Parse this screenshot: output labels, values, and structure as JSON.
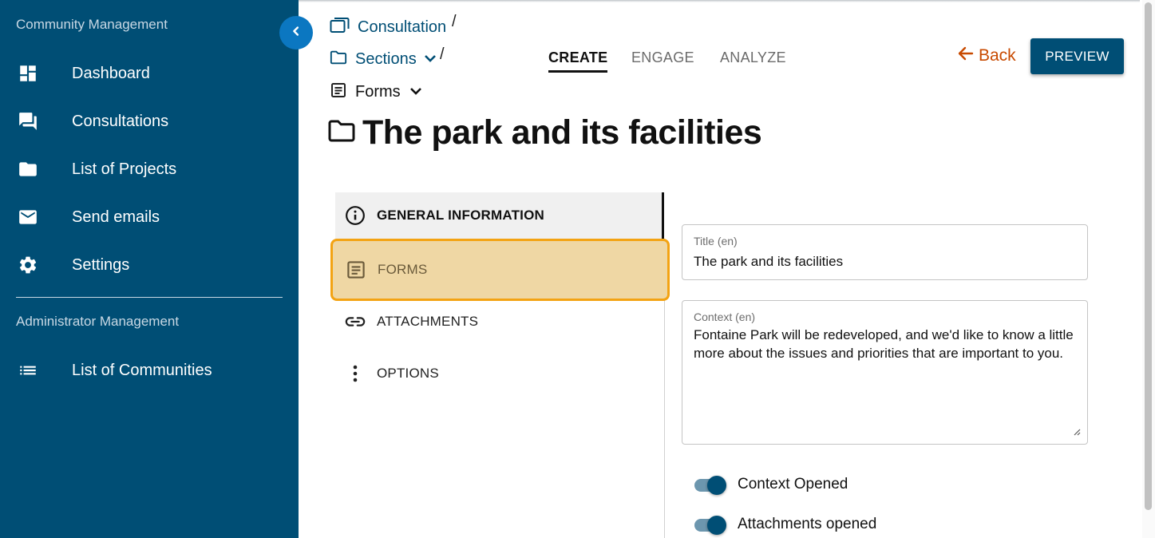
{
  "sidebar": {
    "community_heading": "Community Management",
    "items": [
      {
        "label": "Dashboard",
        "icon": "dashboard-icon"
      },
      {
        "label": "Consultations",
        "icon": "forum-icon"
      },
      {
        "label": "List of Projects",
        "icon": "folder-icon"
      },
      {
        "label": "Send emails",
        "icon": "mail-icon"
      },
      {
        "label": "Settings",
        "icon": "gear-icon"
      }
    ],
    "admin_heading": "Administrator Management",
    "admin_items": [
      {
        "label": "List of Communities",
        "icon": "list-icon"
      }
    ],
    "collapse_icon": "chevron-left-icon",
    "background": "#004e75"
  },
  "breadcrumb": {
    "consultation": "Consultation",
    "sections": "Sections",
    "forms": "Forms",
    "separator": "/"
  },
  "tabs": [
    {
      "label": "CREATE",
      "active": true
    },
    {
      "label": "ENGAGE",
      "active": false
    },
    {
      "label": "ANALYZE",
      "active": false
    }
  ],
  "header": {
    "back_label": "Back",
    "preview_label": "PREVIEW",
    "page_title": "The park and its facilities"
  },
  "menu": {
    "general": "GENERAL INFORMATION",
    "forms": "FORMS",
    "attachments": "ATTACHMENTS",
    "options": "OPTIONS"
  },
  "form": {
    "title_label": "Title (en)",
    "title_value": "The park and its facilities",
    "context_label": "Context (en)",
    "context_value": "Fontaine Park will be redeveloped, and we'd like to know a little more about the issues and priorities that are important to you.",
    "toggles": [
      {
        "label": "Context Opened",
        "on": true
      },
      {
        "label": "Attachments opened",
        "on": true
      }
    ]
  },
  "colors": {
    "primary": "#004e75",
    "accent_blue": "#0b77c1",
    "back_orange": "#c84a00",
    "highlight_fill": "#efd7a4",
    "highlight_border": "#f3a313"
  }
}
